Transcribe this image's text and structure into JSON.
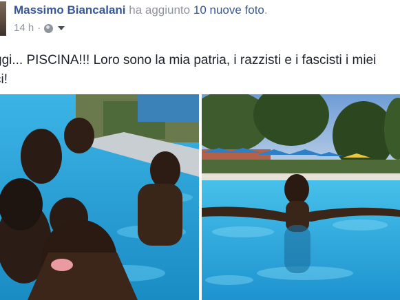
{
  "post": {
    "author": "Massimo Biancalani",
    "action": "ha aggiunto",
    "photo_count": "10 nuove foto",
    "period": ".",
    "timestamp": "14 h",
    "separator": "·",
    "audience_icon": "globe-icon",
    "menu_icon": "chevron-down-icon",
    "text_line1": "ggi... PISCINA!!! Loro sono la mia patria, i razzisti e i fascisti i miei",
    "text_line2": "ci!"
  },
  "photos": [
    {
      "subject": "pool selfie photo"
    },
    {
      "subject": "swimming pool photo"
    }
  ],
  "colors": {
    "link": "#365899",
    "meta": "#90949c",
    "text": "#1d2129",
    "pool": "#2fa9de"
  }
}
